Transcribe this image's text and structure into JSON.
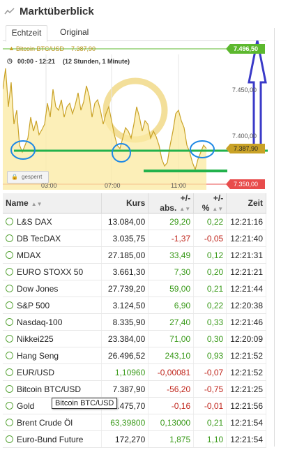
{
  "header": {
    "title": "Marktüberblick"
  },
  "tabs": [
    {
      "label": "Echtzeit"
    },
    {
      "label": "Original"
    }
  ],
  "chart": {
    "instrument": "Bitcoin BTC/USD",
    "price": "7.387,90",
    "range_text": "00:00 - 12:21",
    "range_info": "(12 Stunden, 1 Minute)",
    "high_label": "7.496,50",
    "low_label": "7.350,00",
    "current_label": "7.387,90",
    "y_ticks": [
      "7.450,00",
      "7.400,00"
    ],
    "x_ticks": [
      "03:00",
      "07:00",
      "11:00"
    ],
    "lock_label": "gesperrt",
    "colors": {
      "line": "#c9a227",
      "fill": "#fbe9a0",
      "high": "#5cb82e",
      "low": "#e84c4c",
      "annotation": "#3a3ac8",
      "marker": "#22b24c"
    }
  },
  "table": {
    "headers": {
      "name": "Name",
      "kurs": "Kurs",
      "abs": "+/- abs.",
      "pct": "+/- %",
      "zeit": "Zeit"
    },
    "rows": [
      {
        "name": "L&S DAX",
        "kurs": "13.084,00",
        "abs": "29,20",
        "pct": "0,22",
        "zeit": "12:21:16",
        "dir": "pos"
      },
      {
        "name": "DB TecDAX",
        "kurs": "3.035,75",
        "abs": "-1,37",
        "pct": "-0,05",
        "zeit": "12:21:40",
        "dir": "neg"
      },
      {
        "name": "MDAX",
        "kurs": "27.185,00",
        "abs": "33,49",
        "pct": "0,12",
        "zeit": "12:21:31",
        "dir": "pos"
      },
      {
        "name": "EURO STOXX 50",
        "kurs": "3.661,30",
        "abs": "7,30",
        "pct": "0,20",
        "zeit": "12:21:21",
        "dir": "pos"
      },
      {
        "name": "Dow Jones",
        "kurs": "27.739,20",
        "abs": "59,00",
        "pct": "0,21",
        "zeit": "12:21:44",
        "dir": "pos"
      },
      {
        "name": "S&P 500",
        "kurs": "3.124,50",
        "abs": "6,90",
        "pct": "0,22",
        "zeit": "12:20:38",
        "dir": "pos"
      },
      {
        "name": "Nasdaq-100",
        "kurs": "8.335,90",
        "abs": "27,40",
        "pct": "0,33",
        "zeit": "12:21:46",
        "dir": "pos"
      },
      {
        "name": "Nikkei225",
        "kurs": "23.384,00",
        "abs": "71,00",
        "pct": "0,30",
        "zeit": "12:20:09",
        "dir": "pos"
      },
      {
        "name": "Hang Seng",
        "kurs": "26.496,52",
        "abs": "243,10",
        "pct": "0,93",
        "zeit": "12:21:52",
        "dir": "pos"
      },
      {
        "name": "EUR/USD",
        "kurs": "1,10960",
        "abs": "-0,00081",
        "pct": "-0,07",
        "zeit": "12:21:52",
        "dir": "neg",
        "kurs_dir": "pos"
      },
      {
        "name": "Bitcoin BTC/USD",
        "kurs": "7.387,90",
        "abs": "-56,20",
        "pct": "-0,75",
        "zeit": "12:21:25",
        "dir": "neg"
      },
      {
        "name": "Gold",
        "kurs": "1.475,70",
        "abs": "-0,16",
        "pct": "-0,01",
        "zeit": "12:21:56",
        "dir": "neg"
      },
      {
        "name": "Brent Crude Öl",
        "kurs": "63,39800",
        "abs": "0,13000",
        "pct": "0,21",
        "zeit": "12:21:54",
        "dir": "pos",
        "kurs_dir": "pos"
      },
      {
        "name": "Euro-Bund Future",
        "kurs": "172,270",
        "abs": "1,875",
        "pct": "1,10",
        "zeit": "12:21:54",
        "dir": "pos"
      }
    ]
  },
  "tooltip": {
    "text": "Bitcoin BTC/USD"
  }
}
